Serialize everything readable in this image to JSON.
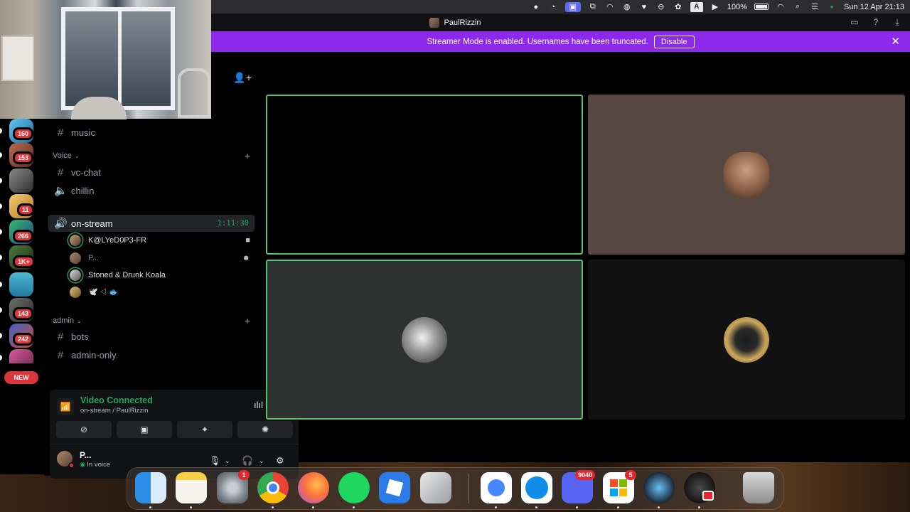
{
  "menubar": {
    "battery": "100%",
    "datetime": "Sun 12 Apr  21:13",
    "items": [
      "circle",
      "pie-chart",
      "screen",
      "cast",
      "activity",
      "game-controller",
      "heart",
      "no-entry",
      "flower",
      "A",
      "play",
      "battery",
      "wifi",
      "search",
      "control-center",
      "status-dot"
    ]
  },
  "window": {
    "title": "PaulRizzin"
  },
  "streamer_banner": {
    "text": "Streamer Mode is enabled. Usernames have been truncated.",
    "button": "Disable",
    "color": "#8d29ea"
  },
  "servers": [
    {
      "badge": "160"
    },
    {
      "badge": "153"
    },
    {
      "badge": ""
    },
    {
      "badge": "11"
    },
    {
      "badge": "266"
    },
    {
      "badge": "1K+"
    },
    {
      "badge": ""
    },
    {
      "badge": "143"
    },
    {
      "badge": "242"
    },
    {
      "badge": ""
    }
  ],
  "new_pill": "NEW",
  "channels": {
    "text_top": "music",
    "voice_category": "Voice",
    "voice_channels": [
      "vc-chat",
      "chillin"
    ],
    "active_channel": "on-stream",
    "active_timer": "1:11:30",
    "voice_users": [
      {
        "name": "K@LYeD0P3-FR",
        "status_icon": "video-camera-icon"
      },
      {
        "name": "P...",
        "status_icon": "emoji-icon"
      },
      {
        "name": "Stoned & Drunk Koala",
        "status_icon": ""
      },
      {
        "name": "🕊️ ⨞ 🐟",
        "status_icon": ""
      }
    ],
    "admin_category": "admin",
    "admin_channels": [
      "bots",
      "admin-only"
    ]
  },
  "voice_panel": {
    "title": "Video Connected",
    "subtitle": "on-stream / PaulRizzin",
    "buttons": [
      "camera-off",
      "screen-share",
      "activities",
      "soundboard"
    ],
    "user_name": "P...",
    "user_status": "In voice"
  },
  "accent": {
    "green": "#23a55a",
    "red": "#da373c"
  },
  "dock": {
    "apps": [
      {
        "name": "Finder",
        "badge": ""
      },
      {
        "name": "Notes",
        "badge": ""
      },
      {
        "name": "System Settings",
        "badge": "1"
      },
      {
        "name": "Chrome",
        "badge": ""
      },
      {
        "name": "Firefox",
        "badge": ""
      },
      {
        "name": "Spotify",
        "badge": ""
      },
      {
        "name": "Roblox",
        "badge": ""
      },
      {
        "name": "iPhone Mirroring",
        "badge": ""
      },
      {
        "name": "NordVPN",
        "badge": ""
      },
      {
        "name": "TeamViewer",
        "badge": ""
      },
      {
        "name": "Discord",
        "badge": "9040"
      },
      {
        "name": "Microsoft",
        "badge": "5"
      },
      {
        "name": "Steam",
        "badge": ""
      },
      {
        "name": "OBS",
        "badge": ""
      },
      {
        "name": "Trash",
        "badge": ""
      }
    ]
  }
}
